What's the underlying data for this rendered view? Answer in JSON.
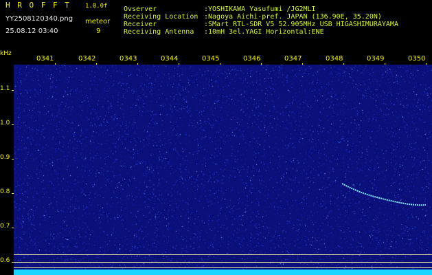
{
  "header": {
    "title": "H R O F F T",
    "version": "1.0.0f",
    "filename": "YY2508120340.png",
    "timestamp": "25.08.12 03:40",
    "meteor_label": "meteor",
    "meteor_count": "9",
    "observer_label": "Ovserver",
    "observer_value": ":YOSHIKAWA Yasufumi /JG2MLI",
    "location_label": "Receiving Location",
    "location_value": ":Nagoya Aichi-pref. JAPAN (136.90E, 35.20N)",
    "receiver_label": "Receiver",
    "receiver_value": ":SMart RTL-SDR V5 52.905MHz USB HIGASHIMURAYAMA",
    "antenna_label": "Receiving Antenna",
    "antenna_value": ":10mH 3el.YAGI Horizontal:ENE"
  },
  "axis": {
    "unit": "kHz",
    "y_ticks": [
      "1.1",
      "1.0",
      "0.9",
      "0.8",
      "0.7",
      "0.6"
    ],
    "x_ticks": [
      "0341",
      "0342",
      "0343",
      "0344",
      "0345",
      "0346",
      "0347",
      "0348",
      "0349",
      "0350"
    ]
  },
  "colors": {
    "background": "#0b0f7a",
    "label_text": "#f2f20a",
    "trail": "#7fe8ff"
  }
}
